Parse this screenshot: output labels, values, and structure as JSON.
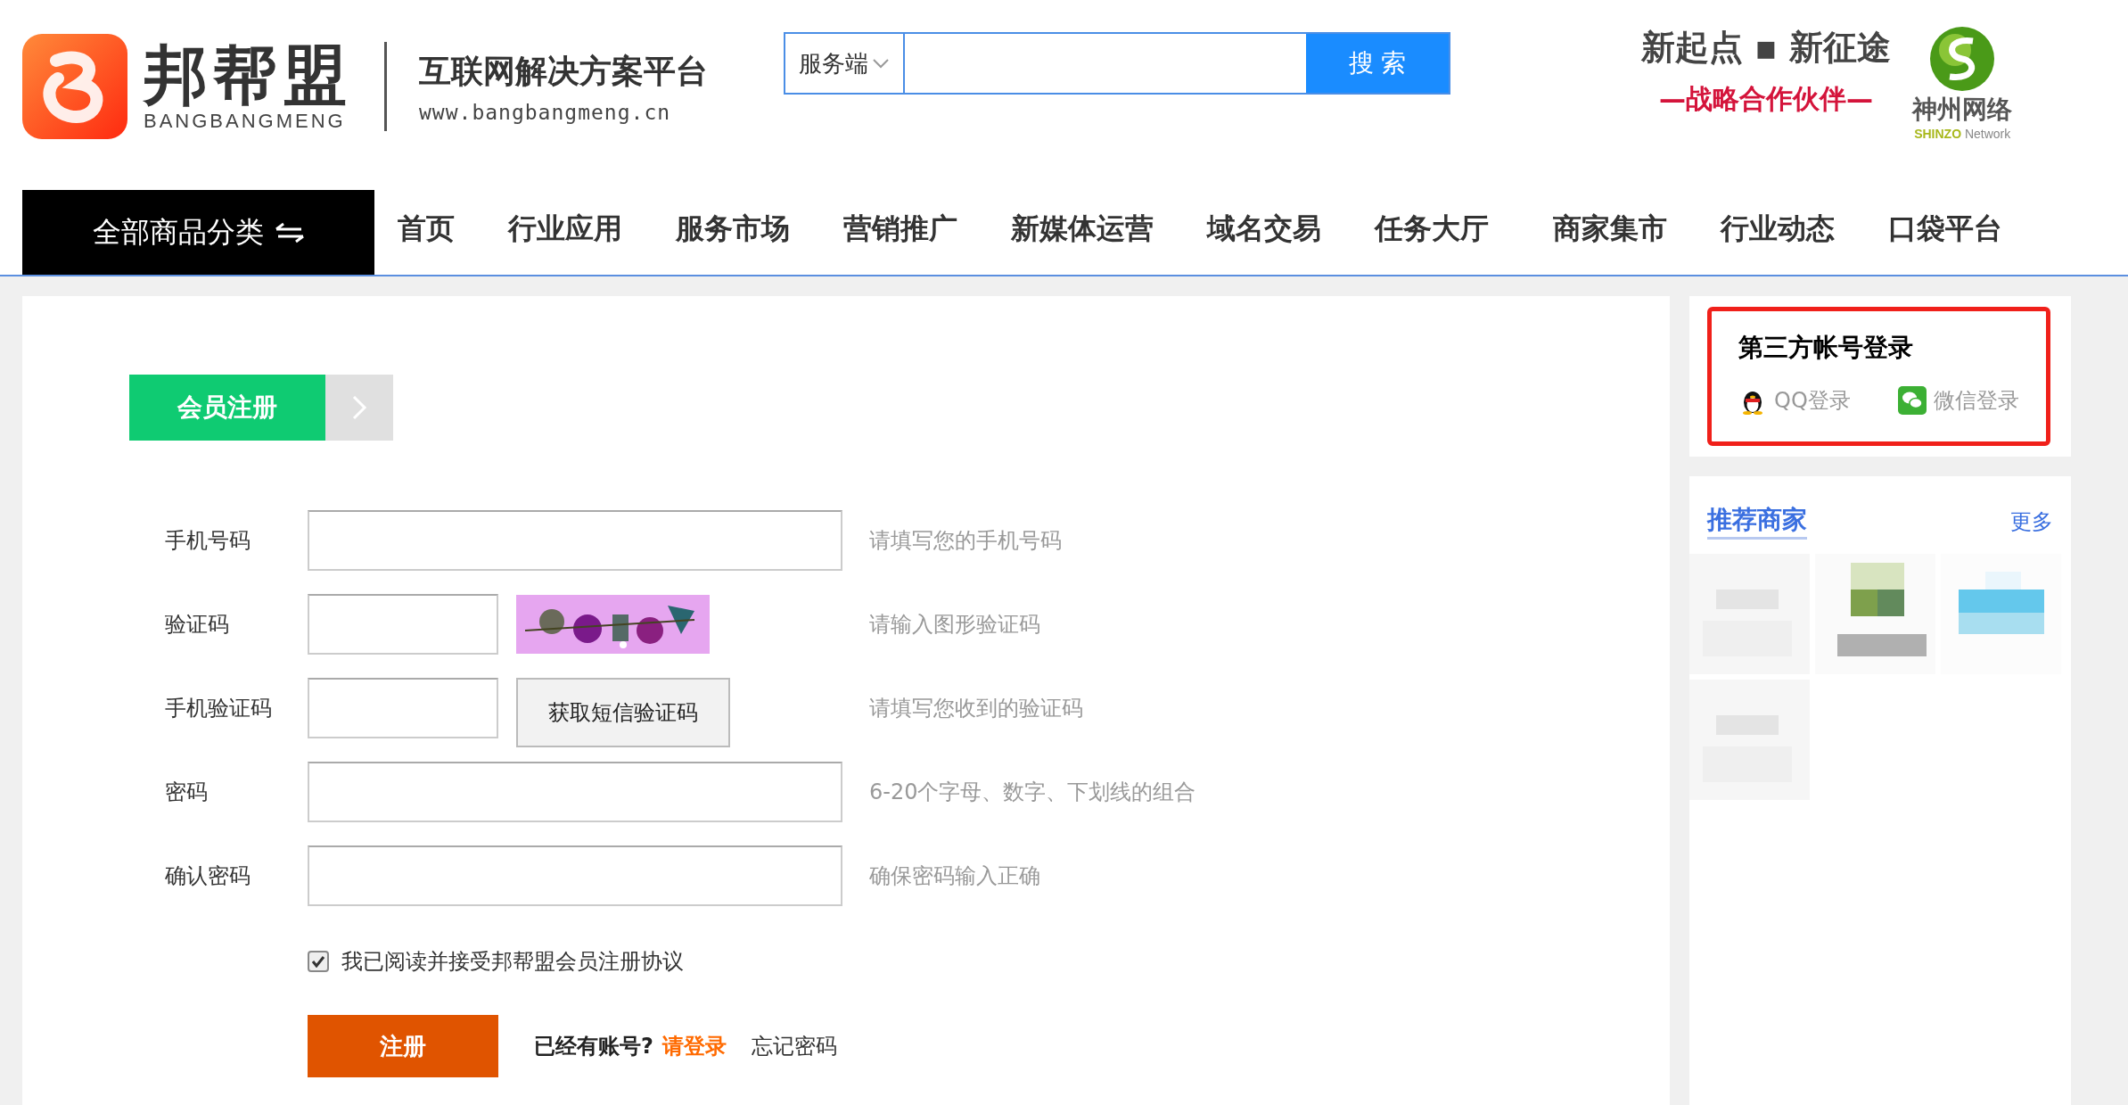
{
  "header": {
    "logo": {
      "name": "邦帮盟",
      "pinyin": "BANGBANGMENG"
    },
    "slogan": "互联网解决方案平台",
    "url": "www.bangbangmeng.cn",
    "search": {
      "scope": "服务端",
      "button": "搜 索"
    },
    "partner": {
      "headline": "新起点 ▪ 新征途",
      "tagline": "—战略合作伙伴—",
      "name": "神州网络",
      "name_en_1": "SHINZO",
      "name_en_2": "Network"
    }
  },
  "nav": {
    "categories": "全部商品分类",
    "items": [
      "首页",
      "行业应用",
      "服务市场",
      "营销推广",
      "新媒体运营",
      "域名交易",
      "任务大厅",
      "商家集市",
      "行业动态",
      "口袋平台"
    ]
  },
  "form": {
    "tabs": [
      {
        "label": "会员注册",
        "selected": true
      }
    ],
    "fields": [
      {
        "kind": "text",
        "label": "手机号码",
        "hint": "请填写您的手机号码"
      },
      {
        "kind": "captcha",
        "label": "验证码",
        "hint": "请输入图形验证码"
      },
      {
        "kind": "sms",
        "label": "手机验证码",
        "button": "获取短信验证码",
        "hint": "请填写您收到的验证码"
      },
      {
        "kind": "text",
        "label": "密码",
        "hint": "6-20个字母、数字、下划线的组合"
      },
      {
        "kind": "text",
        "label": "确认密码",
        "hint": "确保密码输入正确"
      }
    ],
    "agreement": {
      "checked": true,
      "text": "我已阅读并接受邦帮盟会员注册协议"
    },
    "submit": "注册",
    "login_prompt": "已经有账号?",
    "login_link": "请登录",
    "forgot": "忘记密码"
  },
  "sidebar": {
    "third_party": {
      "title": "第三方帐号登录",
      "options": [
        {
          "kind": "qq",
          "label": "QQ登录"
        },
        {
          "kind": "wechat",
          "label": "微信登录"
        }
      ]
    },
    "recommended": {
      "title": "推荐商家",
      "more": "更多"
    }
  }
}
